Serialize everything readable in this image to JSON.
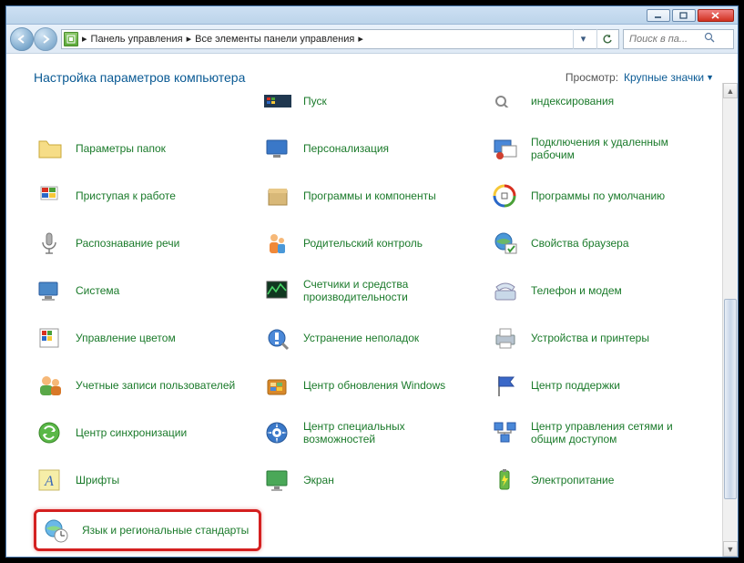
{
  "breadcrumb": {
    "level1": "Панель управления",
    "level2": "Все элементы панели управления"
  },
  "search": {
    "placeholder": "Поиск в па..."
  },
  "header": {
    "title": "Настройка параметров компьютера",
    "view_label": "Просмотр:",
    "view_value": "Крупные значки"
  },
  "items_row0": [
    {
      "label": "Пуск"
    },
    {
      "label": "индексирования"
    }
  ],
  "items": [
    {
      "label": "Параметры папок",
      "icon": "folder"
    },
    {
      "label": "Персонализация",
      "icon": "desktop"
    },
    {
      "label": "Подключения к удаленным рабочим",
      "icon": "remote"
    },
    {
      "label": "Приступая к работе",
      "icon": "flag"
    },
    {
      "label": "Программы и компоненты",
      "icon": "box"
    },
    {
      "label": "Программы по умолчанию",
      "icon": "defaults"
    },
    {
      "label": "Распознавание речи",
      "icon": "mic"
    },
    {
      "label": "Родительский контроль",
      "icon": "family"
    },
    {
      "label": "Свойства браузера",
      "icon": "globe-check"
    },
    {
      "label": "Система",
      "icon": "system"
    },
    {
      "label": "Счетчики и средства производительности",
      "icon": "perf"
    },
    {
      "label": "Телефон и модем",
      "icon": "phone"
    },
    {
      "label": "Управление цветом",
      "icon": "color"
    },
    {
      "label": "Устранение неполадок",
      "icon": "trouble"
    },
    {
      "label": "Устройства и принтеры",
      "icon": "printer"
    },
    {
      "label": "Учетные записи пользователей",
      "icon": "users"
    },
    {
      "label": "Центр обновления Windows",
      "icon": "update"
    },
    {
      "label": "Центр поддержки",
      "icon": "action-flag"
    },
    {
      "label": "Центр синхронизации",
      "icon": "sync"
    },
    {
      "label": "Центр специальных возможностей",
      "icon": "ease"
    },
    {
      "label": "Центр управления сетями и общим доступом",
      "icon": "network"
    },
    {
      "label": "Шрифты",
      "icon": "font"
    },
    {
      "label": "Экран",
      "icon": "screen"
    },
    {
      "label": "Электропитание",
      "icon": "power"
    },
    {
      "label": "Язык и региональные стандарты",
      "icon": "region",
      "highlight": true
    }
  ]
}
